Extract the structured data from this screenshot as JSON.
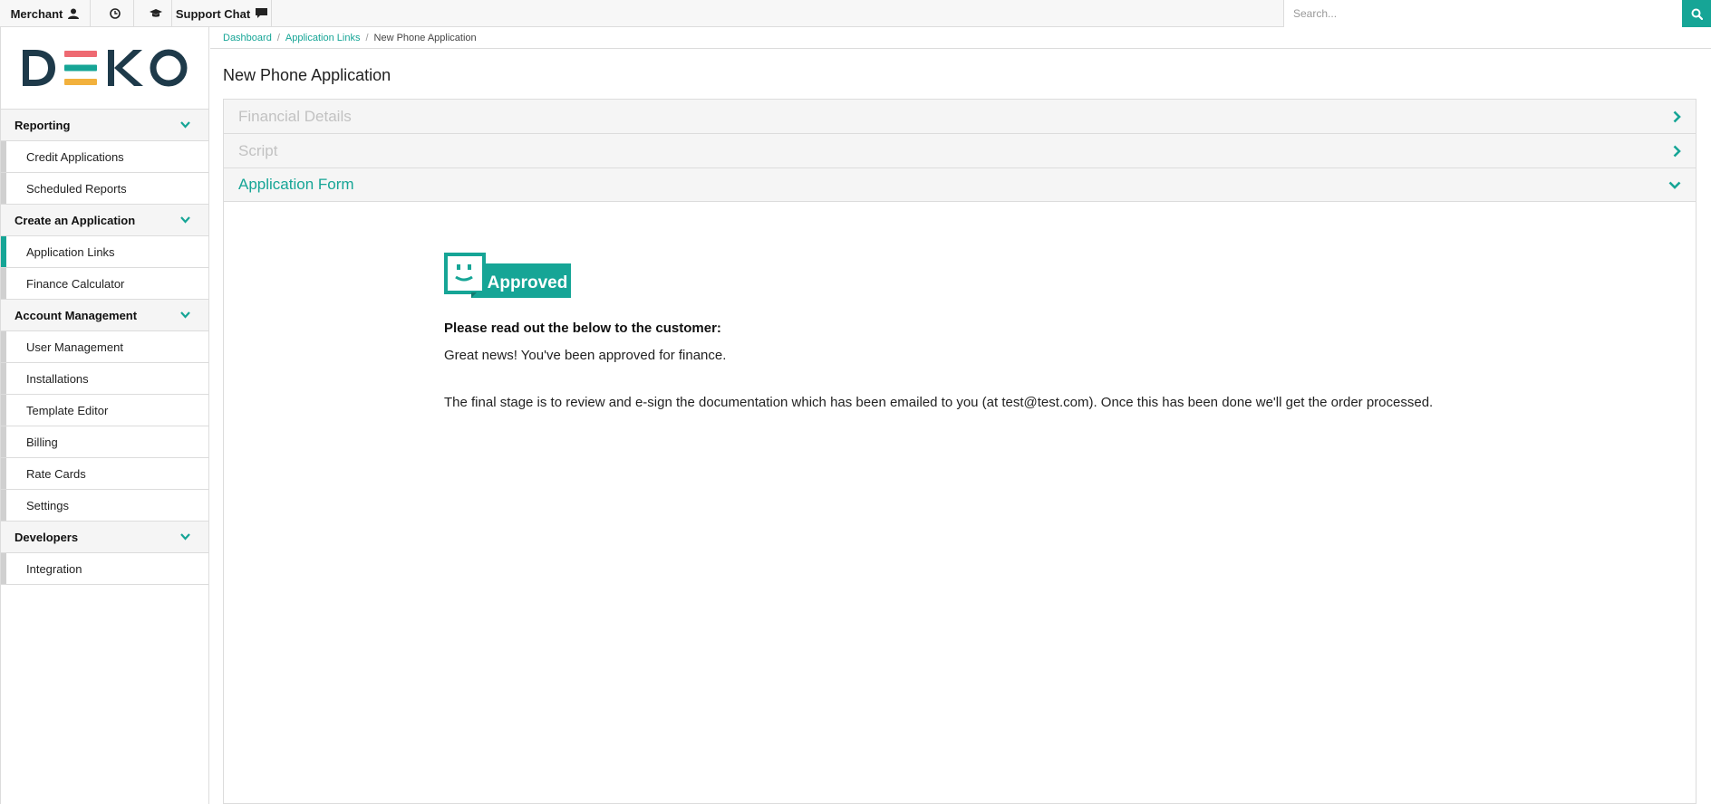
{
  "topbar": {
    "merchant_label": "Merchant",
    "support_label": "Support Chat",
    "search_placeholder": "Search..."
  },
  "sidebar": {
    "logo_text": "DEKO",
    "sections": [
      {
        "label": "Reporting",
        "items": [
          "Credit Applications",
          "Scheduled Reports"
        ]
      },
      {
        "label": "Create an Application",
        "items": [
          "Application Links",
          "Finance Calculator"
        ]
      },
      {
        "label": "Account Management",
        "items": [
          "User Management",
          "Installations",
          "Template Editor",
          "Billing",
          "Rate Cards",
          "Settings"
        ]
      },
      {
        "label": "Developers",
        "items": [
          "Integration"
        ]
      }
    ],
    "active_item": "Application Links"
  },
  "breadcrumb": {
    "items": [
      "Dashboard",
      "Application Links",
      "New Phone Application"
    ]
  },
  "page": {
    "title": "New Phone Application"
  },
  "accordion": {
    "panels": [
      "Financial Details",
      "Script",
      "Application Form"
    ],
    "open_panel": "Application Form"
  },
  "result": {
    "status_label": "Approved",
    "instruction": "Please read out the below to the customer:",
    "message_1": "Great news! You've been approved for finance.",
    "message_2": "The final stage is to review and e-sign the documentation which has been emailed to you (at test@test.com). Once this has been done we'll get the order processed."
  },
  "colors": {
    "accent": "#16a596",
    "logo_bar_top": "#ee6a72",
    "logo_bar_mid": "#16a596",
    "logo_bar_bottom": "#f2b13d",
    "logo_text": "#1e3a4a"
  }
}
